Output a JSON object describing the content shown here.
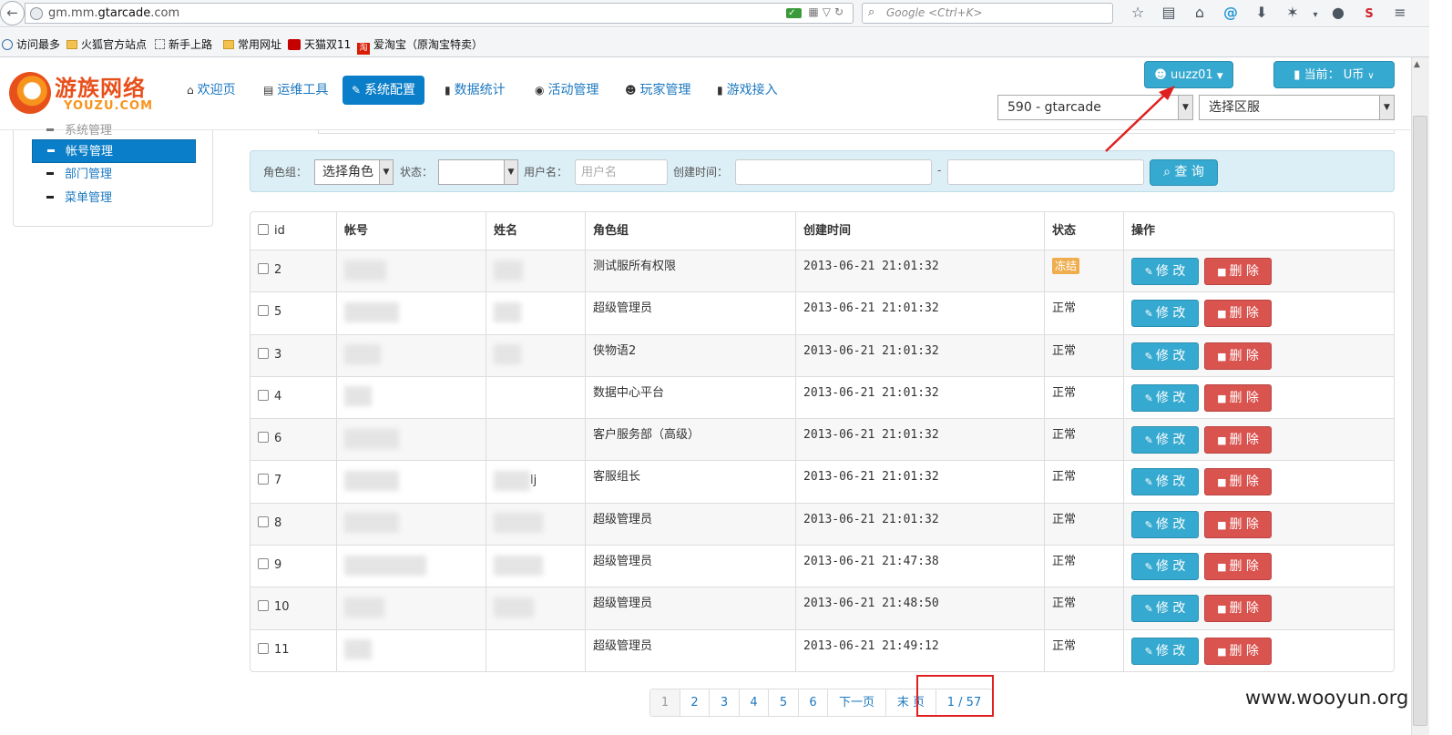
{
  "browser": {
    "url_prefix": "gm.mm.",
    "url_domain": "gtarcade",
    "url_suffix": ".com",
    "search_placeholder": "Google <Ctrl+K>",
    "bookmarks": [
      "访问最多",
      "火狐官方站点",
      "新手上路",
      "常用网址",
      "天猫双11",
      "爱淘宝（原淘宝特卖）"
    ],
    "tao_glyph": "淘",
    "icons": [
      "back-arrow-icon",
      "globe-icon",
      "shield-icon",
      "qr-code-icon",
      "dropdown-icon",
      "reload-icon",
      "search-icon",
      "star-icon",
      "reading-list-icon",
      "home-icon",
      "at-icon",
      "download-icon",
      "addon-icon",
      "chat-icon",
      "s-icon",
      "menu-icon"
    ]
  },
  "logo": {
    "cn": "游族网络",
    "en": "YOUZU.COM"
  },
  "nav": {
    "items": [
      {
        "label": "欢迎页",
        "icon": "home-icon",
        "glyph": "⌂"
      },
      {
        "label": "运维工具",
        "icon": "print-icon",
        "glyph": "▤"
      },
      {
        "label": "系统配置",
        "icon": "wrench-icon",
        "glyph": "✎"
      },
      {
        "label": "数据统计",
        "icon": "signal-icon",
        "glyph": "▮"
      },
      {
        "label": "活动管理",
        "icon": "globe-icon",
        "glyph": "◉"
      },
      {
        "label": "玩家管理",
        "icon": "user-icon",
        "glyph": "☻"
      },
      {
        "label": "游戏接入",
        "icon": "book-icon",
        "glyph": "▮"
      }
    ]
  },
  "user": {
    "name": "uuzz01",
    "current_label": "当前：",
    "currency": "U币"
  },
  "selectors": {
    "server": "590 - gtarcade",
    "area": "选择区服"
  },
  "sidebar": {
    "partial": "系统管理",
    "items": [
      "帐号管理",
      "部门管理",
      "菜单管理"
    ]
  },
  "filter": {
    "role_label": "角色组：",
    "role_value": "选择角色",
    "status_label": "状态：",
    "status_value": "",
    "username_label": "用户名：",
    "username_placeholder": "用户名",
    "created_label": "创建时间：",
    "date_sep": "-",
    "query_button": "查 询"
  },
  "table": {
    "headers": [
      "id",
      "帐号",
      "姓名",
      "角色组",
      "创建时间",
      "状态",
      "操作"
    ],
    "edit_label": "修 改",
    "delete_label": "删 除",
    "rows": [
      {
        "id": "2",
        "name_suffix": "",
        "role": "测试服所有权限",
        "created": "2013-06-21 21:01:32",
        "status": "冻结",
        "frozen": true
      },
      {
        "id": "5",
        "name_suffix": "",
        "role": "超级管理员",
        "created": "2013-06-21 21:01:32",
        "status": "正常",
        "frozen": false
      },
      {
        "id": "3",
        "name_suffix": "",
        "role": "侠物语2",
        "created": "2013-06-21 21:01:32",
        "status": "正常",
        "frozen": false
      },
      {
        "id": "4",
        "name_suffix": "",
        "role": "数据中心平台",
        "created": "2013-06-21 21:01:32",
        "status": "正常",
        "frozen": false
      },
      {
        "id": "6",
        "name_suffix": "",
        "role": "客户服务部（高级）",
        "created": "2013-06-21 21:01:32",
        "status": "正常",
        "frozen": false
      },
      {
        "id": "7",
        "name_suffix": "lj",
        "role": "客服组长",
        "created": "2013-06-21 21:01:32",
        "status": "正常",
        "frozen": false
      },
      {
        "id": "8",
        "name_suffix": "",
        "role": "超级管理员",
        "created": "2013-06-21 21:01:32",
        "status": "正常",
        "frozen": false
      },
      {
        "id": "9",
        "name_suffix": "",
        "role": "超级管理员",
        "created": "2013-06-21 21:47:38",
        "status": "正常",
        "frozen": false
      },
      {
        "id": "10",
        "name_suffix": "",
        "role": "超级管理员",
        "created": "2013-06-21 21:48:50",
        "status": "正常",
        "frozen": false
      },
      {
        "id": "11",
        "name_suffix": "",
        "role": "超级管理员",
        "created": "2013-06-21 21:49:12",
        "status": "正常",
        "frozen": false
      }
    ]
  },
  "pagination": {
    "pages": [
      "1",
      "2",
      "3",
      "4",
      "5",
      "6"
    ],
    "next": "下一页",
    "last": "末 页",
    "current_total": "1 / 57"
  },
  "watermark": "www.wooyun.org",
  "colors": {
    "primary": "#0a7ec8",
    "info": "#36a9d0",
    "danger": "#d9534f",
    "warning": "#f0ad4e",
    "annotation": "#e02020"
  }
}
